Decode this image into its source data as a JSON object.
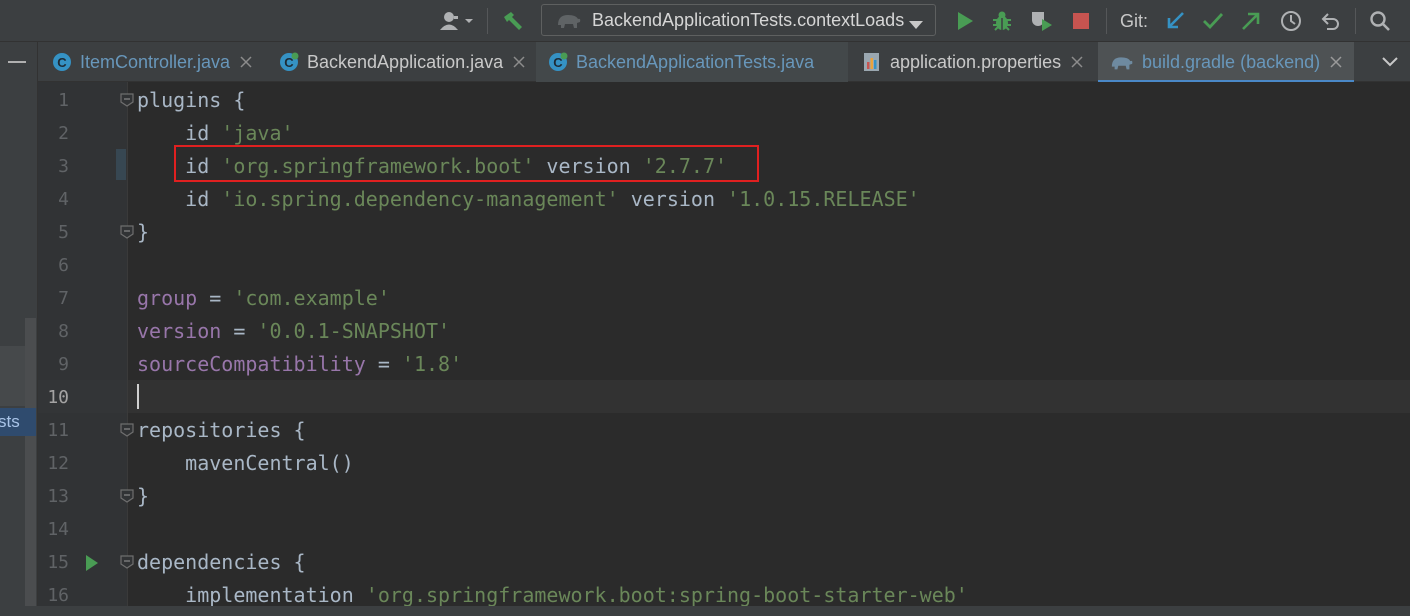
{
  "toolbar": {
    "run_config": "BackendApplicationTests.contextLoads",
    "git_label": "Git:",
    "icons": [
      "user-icon",
      "build-hammer-icon",
      "gradle-elephant-icon",
      "run-icon",
      "debug-icon",
      "coverage-icon",
      "stop-icon",
      "git-update-icon",
      "git-commit-icon",
      "git-push-icon",
      "git-history-icon",
      "git-rollback-icon",
      "search-icon"
    ]
  },
  "left_strip": {
    "label": "sts"
  },
  "tabs": [
    {
      "label": "ItemController.java",
      "icon": "java-class-icon",
      "active": false,
      "color": "#6897bb"
    },
    {
      "label": "BackendApplication.java",
      "icon": "spring-boot-class-icon",
      "active": false,
      "color": "#c9c9c9"
    },
    {
      "label": "BackendApplicationTests.java",
      "icon": "spring-test-class-icon",
      "active": false,
      "color": "#6897bb"
    },
    {
      "label": "application.properties",
      "icon": "properties-icon",
      "active": false,
      "color": "#c9c9c9"
    },
    {
      "label": "build.gradle (backend)",
      "icon": "gradle-elephant-icon",
      "active": true,
      "color": "#6897bb"
    }
  ],
  "editor": {
    "current_line": 10,
    "highlighted_line": 3,
    "lines": [
      {
        "n": "1",
        "tokens": [
          {
            "t": "plugins {",
            "c": "plain"
          }
        ]
      },
      {
        "n": "2",
        "tokens": [
          {
            "t": "    id ",
            "c": "plain"
          },
          {
            "t": "'java'",
            "c": "str"
          }
        ]
      },
      {
        "n": "3",
        "tokens": [
          {
            "t": "    id ",
            "c": "plain"
          },
          {
            "t": "'org.springframework.boot'",
            "c": "str"
          },
          {
            "t": " version ",
            "c": "plain"
          },
          {
            "t": "'2.7.7'",
            "c": "str"
          }
        ]
      },
      {
        "n": "4",
        "tokens": [
          {
            "t": "    id ",
            "c": "plain"
          },
          {
            "t": "'io.spring.dependency-management'",
            "c": "str"
          },
          {
            "t": " version ",
            "c": "plain"
          },
          {
            "t": "'1.0.15.RELEASE'",
            "c": "str"
          }
        ]
      },
      {
        "n": "5",
        "tokens": [
          {
            "t": "}",
            "c": "plain"
          }
        ]
      },
      {
        "n": "6",
        "tokens": []
      },
      {
        "n": "7",
        "tokens": [
          {
            "t": "group",
            "c": "prop"
          },
          {
            "t": " = ",
            "c": "plain"
          },
          {
            "t": "'com.example'",
            "c": "str"
          }
        ]
      },
      {
        "n": "8",
        "tokens": [
          {
            "t": "version",
            "c": "prop"
          },
          {
            "t": " = ",
            "c": "plain"
          },
          {
            "t": "'0.0.1-SNAPSHOT'",
            "c": "str"
          }
        ]
      },
      {
        "n": "9",
        "tokens": [
          {
            "t": "sourceCompatibility",
            "c": "prop"
          },
          {
            "t": " = ",
            "c": "plain"
          },
          {
            "t": "'1.8'",
            "c": "str"
          }
        ]
      },
      {
        "n": "10",
        "tokens": []
      },
      {
        "n": "11",
        "tokens": [
          {
            "t": "repositories {",
            "c": "plain"
          }
        ]
      },
      {
        "n": "12",
        "tokens": [
          {
            "t": "    mavenCentral()",
            "c": "plain"
          }
        ]
      },
      {
        "n": "13",
        "tokens": [
          {
            "t": "}",
            "c": "plain"
          }
        ]
      },
      {
        "n": "14",
        "tokens": []
      },
      {
        "n": "15",
        "tokens": [
          {
            "t": "dependencies {",
            "c": "plain"
          }
        ]
      },
      {
        "n": "16",
        "tokens": [
          {
            "t": "    implementation ",
            "c": "plain"
          },
          {
            "t": "'org.springframework.boot:spring-boot-starter-web'",
            "c": "str"
          }
        ]
      }
    ],
    "fold_lines": [
      1,
      5,
      11,
      13,
      15
    ],
    "run_gutter_line": 15
  },
  "colors": {
    "string": "#6a8759",
    "property": "#9876aa",
    "plain": "#a9b7c6",
    "highlight_box": "#e02020",
    "run_green": "#499c54",
    "stop_red": "#c75450"
  }
}
